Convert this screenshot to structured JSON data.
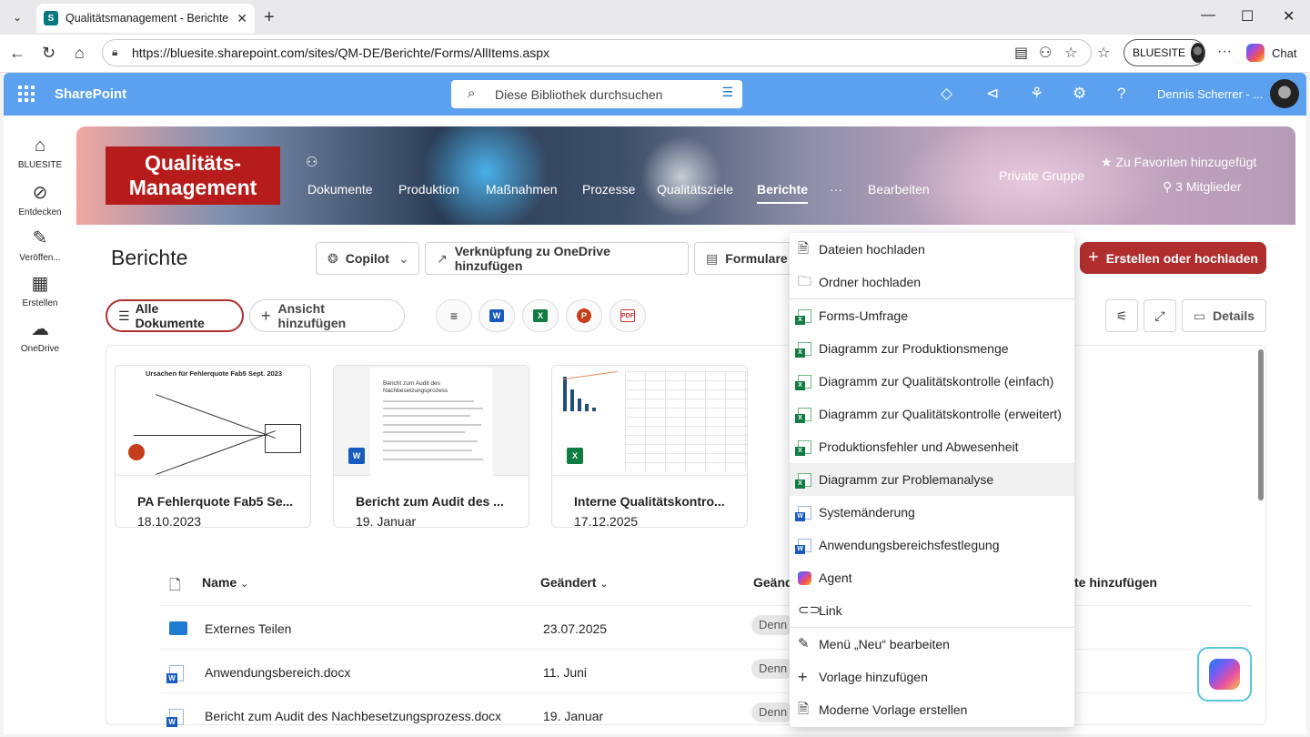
{
  "browser": {
    "tab_title": "Qualitätsmanagement - Berichte - ...",
    "url": "https://bluesite.sharepoint.com/sites/QM-DE/Berichte/Forms/AllItems.aspx",
    "profile_label": "BLUESITE",
    "chat_label": "Chat"
  },
  "suitebar": {
    "app_name": "SharePoint",
    "search_placeholder": "Diese Bibliothek durchsuchen",
    "user_name": "Dennis Scherrer - ..."
  },
  "leftrail": {
    "items": [
      {
        "label": "BLUESITE",
        "icon": "home-icon"
      },
      {
        "label": "Entdecken",
        "icon": "compass-icon"
      },
      {
        "label": "Veröffen...",
        "icon": "pen-icon"
      },
      {
        "label": "Erstellen",
        "icon": "grid-icon"
      },
      {
        "label": "OneDrive",
        "icon": "cloud-icon"
      }
    ]
  },
  "hero": {
    "logo_line1": "Qualitäts-",
    "logo_line2": "Management",
    "nav": [
      "Dokumente",
      "Produktion",
      "Maßnahmen",
      "Prozesse",
      "Qualitätsziele",
      "Berichte",
      "···",
      "Bearbeiten"
    ],
    "active_nav": "Berichte",
    "group_type": "Private Gruppe",
    "favorite_label": "Zu Favoriten hinzugefügt",
    "members_label": "3 Mitglieder"
  },
  "commandbar": {
    "page_title": "Berichte",
    "copilot_label": "Copilot",
    "onedrive_label": "Verknüpfung zu OneDrive hinzufügen",
    "forms_label": "Formulare",
    "create_label": "Erstellen oder hochladen"
  },
  "views": {
    "all_docs_label": "Alle Dokumente",
    "add_view_label": "Ansicht hinzufügen",
    "details_label": "Details"
  },
  "cards": [
    {
      "name": "PA Fehlerquote Fab5 Se...",
      "date": "18.10.2023",
      "type": "powerpoint",
      "thumb_title": "Ursachen für Fehlerquote Fab5 Sept. 2023"
    },
    {
      "name": "Bericht zum Audit des ...",
      "date": "19. Januar",
      "type": "word",
      "thumb_title": "Bericht zum Audit des Nachbesetzungsprozess"
    },
    {
      "name": "Interne Qualitätskontro...",
      "date": "17.12.2025",
      "type": "excel"
    }
  ],
  "list": {
    "col_name": "Name",
    "col_modified": "Geändert",
    "col_modified_by": "Geänd",
    "col_add": "te hinzufügen",
    "rows": [
      {
        "name": "Externes Teilen",
        "modified": "23.07.2025",
        "by": "Denn",
        "type": "folder"
      },
      {
        "name": "Anwendungsbereich.docx",
        "modified": "11. Juni",
        "by": "Denn",
        "type": "word"
      },
      {
        "name": "Bericht zum Audit des Nachbesetzungsprozess.docx",
        "modified": "19. Januar",
        "by": "Denn",
        "type": "word"
      }
    ]
  },
  "menu": {
    "items": [
      {
        "label": "Dateien hochladen",
        "icon": "file-upload-icon"
      },
      {
        "label": "Ordner hochladen",
        "icon": "folder-upload-icon"
      },
      {
        "label": "Forms-Umfrage",
        "icon": "excel-icon"
      },
      {
        "label": "Diagramm zur Produktionsmenge",
        "icon": "excel-icon"
      },
      {
        "label": "Diagramm zur Qualitätskontrolle (einfach)",
        "icon": "excel-icon"
      },
      {
        "label": "Diagramm zur Qualitätskontrolle (erweitert)",
        "icon": "excel-icon"
      },
      {
        "label": "Produktionsfehler und Abwesenheit",
        "icon": "excel-icon"
      },
      {
        "label": "Diagramm zur Problemanalyse",
        "icon": "excel-icon"
      },
      {
        "label": "Systemänderung",
        "icon": "word-icon"
      },
      {
        "label": "Anwendungsbereichsfestlegung",
        "icon": "word-icon"
      },
      {
        "label": "Agent",
        "icon": "agent-icon"
      },
      {
        "label": "Link",
        "icon": "link-icon"
      },
      {
        "label": "Menü „Neu“ bearbeiten",
        "icon": "pencil-icon"
      },
      {
        "label": "Vorlage hinzufügen",
        "icon": "plus-icon"
      },
      {
        "label": "Moderne Vorlage erstellen",
        "icon": "template-icon"
      }
    ]
  },
  "colors": {
    "suitebar": "#5ca1f0",
    "create_button": "#b02e2e",
    "logo_bg": "#b71c1c"
  }
}
